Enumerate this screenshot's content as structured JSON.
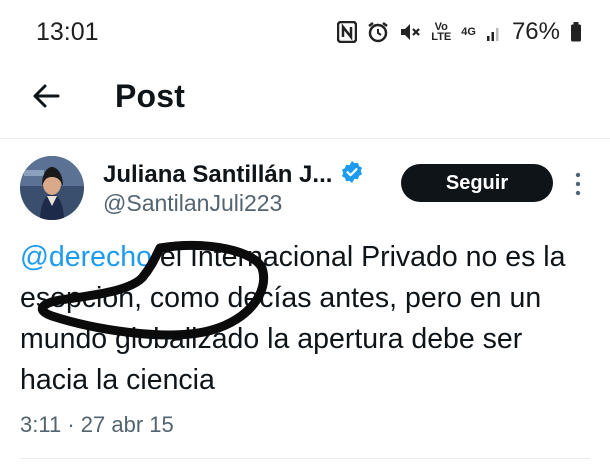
{
  "status_bar": {
    "time": "13:01",
    "icons": [
      "nfc-icon",
      "alarm-icon",
      "mute-icon",
      "volte-icon",
      "4g-icon",
      "signal-icon",
      "battery-icon"
    ],
    "volte_label": "Vo\nLTE",
    "network_label": "4G",
    "battery": "76%"
  },
  "header": {
    "title": "Post"
  },
  "tweet": {
    "author_name": "Juliana Santillán J...",
    "handle": "@SantilanJuli223",
    "follow_label": "Seguir",
    "mention": "@derecho",
    "text_rest": " el Internacional Privado no es la esepcion, como decías antes, pero en un mundo globalizado la apertura debe ser hacia la ciencia",
    "time": "3:11",
    "separator": "·",
    "date": "27 abr 15"
  },
  "colors": {
    "accent": "#1d9bf0",
    "text": "#0f1419",
    "muted": "#536471",
    "verified": "#1d9bf0"
  }
}
